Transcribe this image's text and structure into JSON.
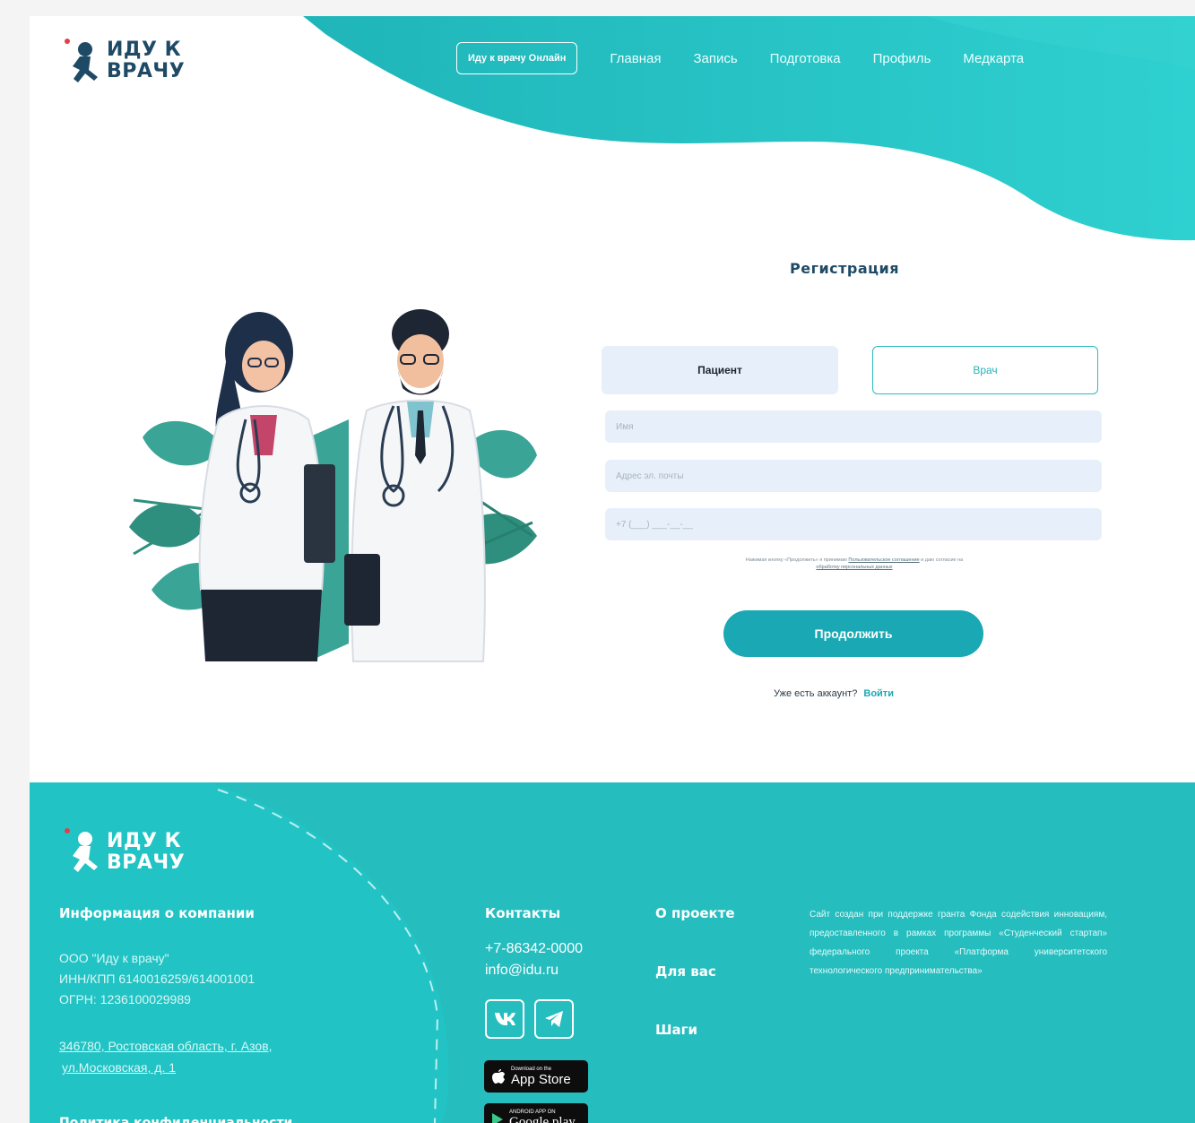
{
  "brand": {
    "logo_text_line1": "ИДУ К",
    "logo_text_line2": "ВРАЧУ"
  },
  "header": {
    "online_button": "Иду к врачу Онлайн",
    "nav": [
      "Главная",
      "Запись",
      "Подготовка",
      "Профиль",
      "Медкарта"
    ]
  },
  "colors": {
    "accent": "#1aa9b4",
    "wave": "#22c0c4",
    "footer": "#26bdbf",
    "field": "#e7f0fa"
  },
  "registration": {
    "title": "Регистрация",
    "role_patient": "Пациент",
    "role_doctor": "Врач",
    "field_name_placeholder": "Имя",
    "field_email_placeholder": "Адрес эл. почты",
    "field_phone_placeholder": "+7 (___) ___-__-__",
    "consent_text": "Нажимая кнопку «Продолжить» я принимаю",
    "consent_link1": "Пользовательское соглашение",
    "consent_text2": "и даю согласие на",
    "consent_link2": "обработку персональных данных",
    "continue_button": "Продолжить",
    "have_account": "Уже есть аккаунт?",
    "login_link": "Войти"
  },
  "footer": {
    "company_heading": "Информация о компании",
    "company_name": "ООО \"Иду к врачу\"",
    "inn": "ИНН/КПП 6140016259/614001001",
    "ogrn": "ОГРН: 1236100029989",
    "address_line1": "346780, Ростовская область, г. Азов,",
    "address_line2": "ул.Московская, д. 1",
    "privacy_heading": "Политика конфиденциальности",
    "contacts_heading": "Контакты",
    "phone": "+7-86342-0000",
    "email": "info@idu.ru",
    "social": [
      "vk-icon",
      "telegram-icon"
    ],
    "app_store_small": "Download on the",
    "app_store_big": "App Store",
    "google_play_small": "ANDROID APP ON",
    "google_play_big": "Google play",
    "menu": [
      "О проекте",
      "Для вас",
      "Шаги"
    ],
    "about_text": "Сайт создан при поддержке гранта Фонда содействия инновациям, предоставленного в рамках программы «Студенческий стартап» федерального проекта «Платформа университетского технологического предпринимательства»"
  }
}
